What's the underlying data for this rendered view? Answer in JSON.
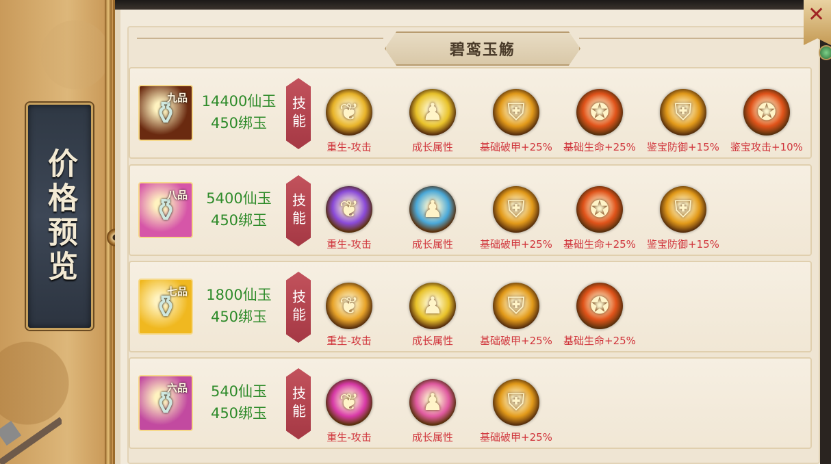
{
  "side_tab": {
    "label": "价格预览"
  },
  "title": "碧鸾玉觞",
  "skill_tag_label": "技能",
  "close_icon": "close-icon",
  "colors": {
    "price_green": "#2e8b2a",
    "skill_red": "#d0333a",
    "tag_red": "#a53844"
  },
  "rows": [
    {
      "grade": "九品",
      "price_xianyu": "14400仙玉",
      "price_bangyu": "450绑玉",
      "item_bg": "#6a2a10",
      "skills": [
        {
          "label": "重生-攻击",
          "icon": "phoenix-icon",
          "color": "#e8b42a"
        },
        {
          "label": "成长属性",
          "icon": "growth-figure-icon",
          "color": "#e8c22a"
        },
        {
          "label": "基础破甲+25%",
          "icon": "broken-shield-icon",
          "color": "#e29a1a"
        },
        {
          "label": "基础生命+25%",
          "icon": "strength-icon",
          "color": "#e0531a"
        },
        {
          "label": "鉴宝防御+15%",
          "icon": "broken-shield-icon",
          "color": "#e29a1a"
        },
        {
          "label": "鉴宝攻击+10%",
          "icon": "strength-icon",
          "color": "#e0531a"
        }
      ]
    },
    {
      "grade": "八品",
      "price_xianyu": "5400仙玉",
      "price_bangyu": "450绑玉",
      "item_bg": "#d656a8",
      "skills": [
        {
          "label": "重生-攻击",
          "icon": "phoenix-icon",
          "color": "#8a4ad8"
        },
        {
          "label": "成长属性",
          "icon": "growth-figure-icon",
          "color": "#4aa8d8"
        },
        {
          "label": "基础破甲+25%",
          "icon": "broken-shield-icon",
          "color": "#e29a1a"
        },
        {
          "label": "基础生命+25%",
          "icon": "strength-icon",
          "color": "#e0531a"
        },
        {
          "label": "鉴宝防御+15%",
          "icon": "broken-shield-icon",
          "color": "#e29a1a"
        }
      ]
    },
    {
      "grade": "七品",
      "price_xianyu": "1800仙玉",
      "price_bangyu": "450绑玉",
      "item_bg": "#f0b820",
      "skills": [
        {
          "label": "重生-攻击",
          "icon": "phoenix-icon",
          "color": "#e8a42a"
        },
        {
          "label": "成长属性",
          "icon": "growth-figure-icon",
          "color": "#e8c22a"
        },
        {
          "label": "基础破甲+25%",
          "icon": "broken-shield-icon",
          "color": "#e29a1a"
        },
        {
          "label": "基础生命+25%",
          "icon": "strength-icon",
          "color": "#e0531a"
        }
      ]
    },
    {
      "grade": "六品",
      "price_xianyu": "540仙玉",
      "price_bangyu": "450绑玉",
      "item_bg": "#c24aa0",
      "skills": [
        {
          "label": "重生-攻击",
          "icon": "phoenix-icon",
          "color": "#d83aa8"
        },
        {
          "label": "成长属性",
          "icon": "growth-figure-icon",
          "color": "#e05aa0"
        },
        {
          "label": "基础破甲+25%",
          "icon": "broken-shield-icon",
          "color": "#e29a1a"
        }
      ]
    }
  ]
}
